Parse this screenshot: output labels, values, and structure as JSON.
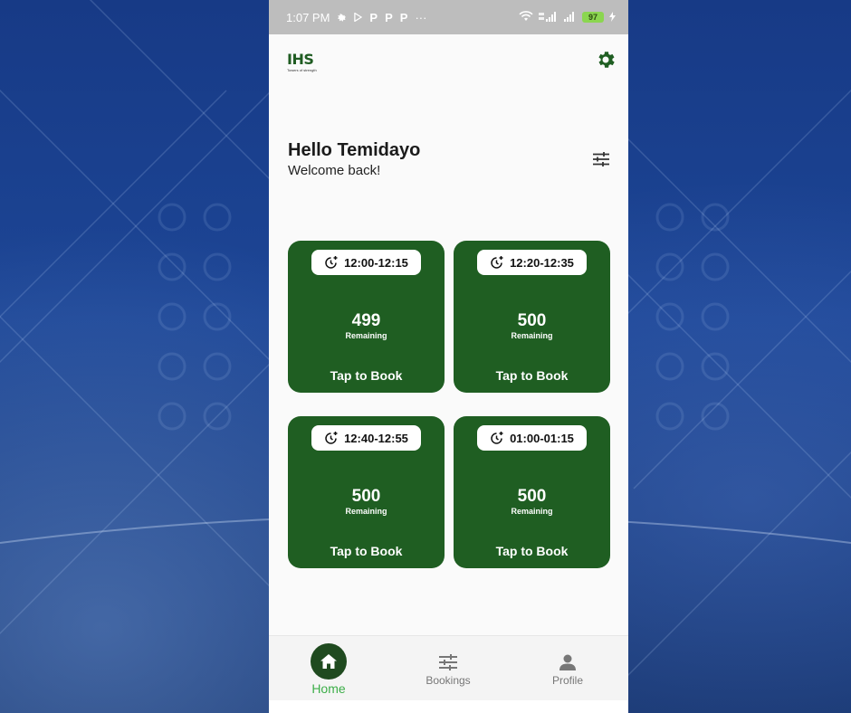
{
  "status_bar": {
    "time": "1:07 PM",
    "notification_glyphs": [
      "P",
      "P",
      "P"
    ],
    "more": "···",
    "battery": "97"
  },
  "header": {
    "logo_text": "IHS",
    "logo_tagline": "Towers of strength"
  },
  "greeting": {
    "title": "Hello Temidayo",
    "subtitle": "Welcome back!"
  },
  "slots": [
    {
      "time": "12:00-12:15",
      "count": "499",
      "remaining_label": "Remaining",
      "action": "Tap to Book"
    },
    {
      "time": "12:20-12:35",
      "count": "500",
      "remaining_label": "Remaining",
      "action": "Tap to Book"
    },
    {
      "time": "12:40-12:55",
      "count": "500",
      "remaining_label": "Remaining",
      "action": "Tap to Book"
    },
    {
      "time": "01:00-01:15",
      "count": "500",
      "remaining_label": "Remaining",
      "action": "Tap to Book"
    }
  ],
  "nav": {
    "home": "Home",
    "bookings": "Bookings",
    "profile": "Profile"
  },
  "colors": {
    "brand_green": "#1f5e22",
    "active_nav": "#3cae48",
    "status_bar": "#bdbdbd"
  }
}
